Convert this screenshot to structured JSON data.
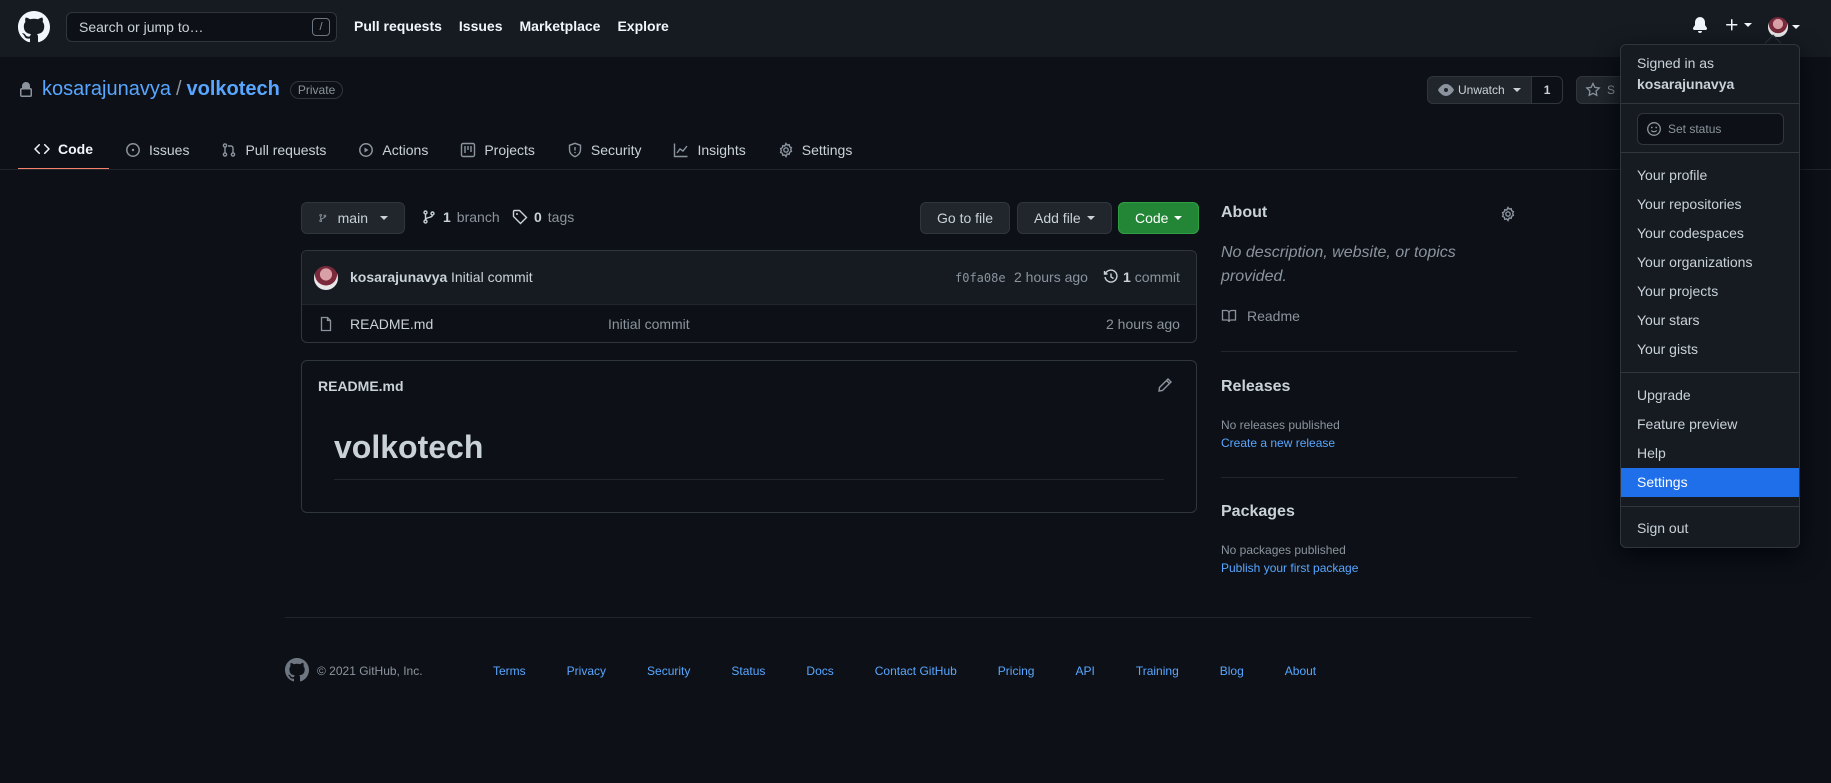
{
  "header": {
    "search_placeholder": "Search or jump to…",
    "slash_key": "/",
    "nav": [
      "Pull requests",
      "Issues",
      "Marketplace",
      "Explore"
    ]
  },
  "repo": {
    "owner": "kosarajunavya",
    "separator": "/",
    "name": "volkotech",
    "visibility": "Private",
    "watch_label": "Unwatch",
    "watch_count": "1",
    "star_label": "S"
  },
  "tabs": [
    "Code",
    "Issues",
    "Pull requests",
    "Actions",
    "Projects",
    "Security",
    "Insights",
    "Settings"
  ],
  "toolbar": {
    "branch": "main",
    "branch_count": "1",
    "branch_label": "branch",
    "tag_count": "0",
    "tag_label": "tags",
    "go_to_file": "Go to file",
    "add_file": "Add file",
    "code": "Code"
  },
  "commit": {
    "author": "kosarajunavya",
    "message": "Initial commit",
    "sha": "f0fa08e",
    "time": "2 hours ago",
    "count": "1",
    "count_label": "commit"
  },
  "files": [
    {
      "name": "README.md",
      "message": "Initial commit",
      "time": "2 hours ago"
    }
  ],
  "readme": {
    "filename": "README.md",
    "heading": "volkotech"
  },
  "about": {
    "title": "About",
    "description": "No description, website, or topics provided.",
    "readme_link": "Readme"
  },
  "releases": {
    "title": "Releases",
    "empty": "No releases published",
    "link": "Create a new release"
  },
  "packages": {
    "title": "Packages",
    "empty": "No packages published",
    "link": "Publish your first package"
  },
  "footer": {
    "copyright": "© 2021 GitHub, Inc.",
    "links": [
      "Terms",
      "Privacy",
      "Security",
      "Status",
      "Docs",
      "Contact GitHub",
      "Pricing",
      "API",
      "Training",
      "Blog",
      "About"
    ]
  },
  "user_menu": {
    "signed_in_as": "Signed in as",
    "username": "kosarajunavya",
    "set_status": "Set status",
    "group1": [
      "Your profile",
      "Your repositories",
      "Your codespaces",
      "Your organizations",
      "Your projects",
      "Your stars",
      "Your gists"
    ],
    "group2": [
      "Upgrade",
      "Feature preview",
      "Help",
      "Settings"
    ],
    "sign_out": "Sign out",
    "selected": "Settings"
  },
  "colors": {
    "accent_link": "#58a6ff",
    "active_tab_underline": "#f78166",
    "code_button": "#238636",
    "menu_selected": "#1f6feb"
  }
}
